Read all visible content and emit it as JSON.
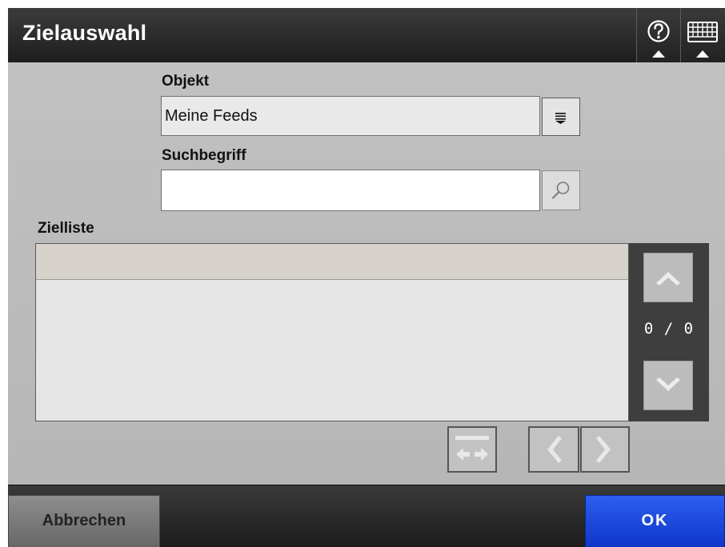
{
  "header": {
    "title": "Zielauswahl",
    "help_icon": "help-icon",
    "keyboard_icon": "keyboard-icon"
  },
  "objekt": {
    "label": "Objekt",
    "value": "Meine Feeds",
    "dropdown_icon": "dropdown-icon"
  },
  "search": {
    "label": "Suchbegriff",
    "value": "",
    "placeholder": "",
    "icon": "search-icon"
  },
  "target_list": {
    "label": "Zielliste",
    "rows": []
  },
  "pagination": {
    "counter": "0 / 0",
    "up_icon": "chevron-up-icon",
    "down_icon": "chevron-down-icon"
  },
  "nav_icons": [
    "swap-icon",
    "chevron-left-icon",
    "chevron-right-icon"
  ],
  "footer": {
    "cancel_label": "Abbrechen",
    "ok_label": "OK"
  },
  "colors": {
    "ok_button": "#1e48dd",
    "header_bg": "#2b2b2b",
    "content_bg": "#bcbcbc"
  }
}
